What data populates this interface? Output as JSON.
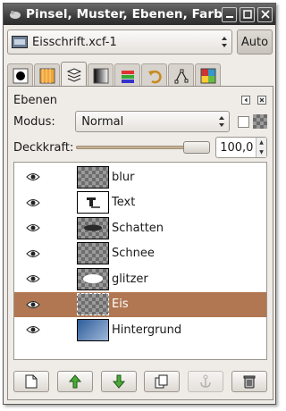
{
  "window": {
    "title": "Pinsel, Muster, Ebenen, Farbv",
    "buttons": [
      "minimize",
      "maximize",
      "close"
    ]
  },
  "image_selector": {
    "value": "Eisschrift.xcf-1",
    "auto_label": "Auto"
  },
  "tabs": [
    {
      "icon": "brush-icon",
      "active": false
    },
    {
      "icon": "pattern-icon",
      "active": false
    },
    {
      "icon": "layers-icon",
      "active": true
    },
    {
      "icon": "gradient-icon",
      "active": false
    },
    {
      "icon": "channels-icon",
      "active": false
    },
    {
      "icon": "undo-history-icon",
      "active": false
    },
    {
      "icon": "paths-icon",
      "active": false
    },
    {
      "icon": "palette-icon",
      "active": false
    }
  ],
  "layers_panel": {
    "title": "Ebenen",
    "mode_label": "Modus:",
    "mode_value": "Normal",
    "opacity_label": "Deckkraft:",
    "opacity_value": "100,0",
    "opacity_fraction": 1.0,
    "layers": [
      {
        "name": "blur",
        "visible": true,
        "selected": false,
        "thumb": "checker"
      },
      {
        "name": "Text",
        "visible": true,
        "selected": false,
        "thumb": "text-layer"
      },
      {
        "name": "Schatten",
        "visible": true,
        "selected": false,
        "thumb": "checker-text"
      },
      {
        "name": "Schnee",
        "visible": true,
        "selected": false,
        "thumb": "checker"
      },
      {
        "name": "glitzer",
        "visible": true,
        "selected": false,
        "thumb": "checker-white"
      },
      {
        "name": "Eis",
        "visible": true,
        "selected": true,
        "thumb": "checker"
      },
      {
        "name": "Hintergrund",
        "visible": true,
        "selected": false,
        "thumb": "blue-gradient"
      }
    ]
  },
  "bottom_buttons": [
    {
      "icon": "new-layer-icon",
      "enabled": true
    },
    {
      "icon": "raise-layer-icon",
      "enabled": true
    },
    {
      "icon": "lower-layer-icon",
      "enabled": true
    },
    {
      "icon": "duplicate-layer-icon",
      "enabled": true
    },
    {
      "icon": "anchor-layer-icon",
      "enabled": false
    },
    {
      "icon": "delete-layer-icon",
      "enabled": true
    }
  ],
  "colors": {
    "selection": "#b07752",
    "window_bg": "#efebe7",
    "slider_fill": "#c9b08f"
  }
}
